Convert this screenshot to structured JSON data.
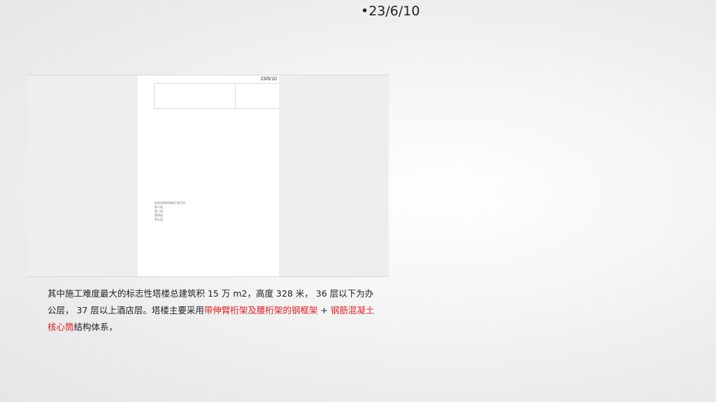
{
  "slide": {
    "date": "•23/6/10"
  },
  "figure": {
    "page_date": "23/6/10",
    "list_items": [
      "标准化钢结构施工各项式",
      "第二段",
      "第三段",
      "第四段",
      "第五段"
    ]
  },
  "body": {
    "part1": "其中施工难度最大的标志性塔楼总建筑积 15 万 m2，高度 328 米， 36 层以下为办公层， 37 层以上酒店层。塔楼主要采用",
    "highlight1": "带伸臂桁架及腰桁架的钢框架",
    "part2": " + ",
    "highlight2": "钢筋混凝土核心筒",
    "part3": "结构体系，"
  },
  "colors": {
    "highlight": "#e02020",
    "text": "#222222"
  }
}
